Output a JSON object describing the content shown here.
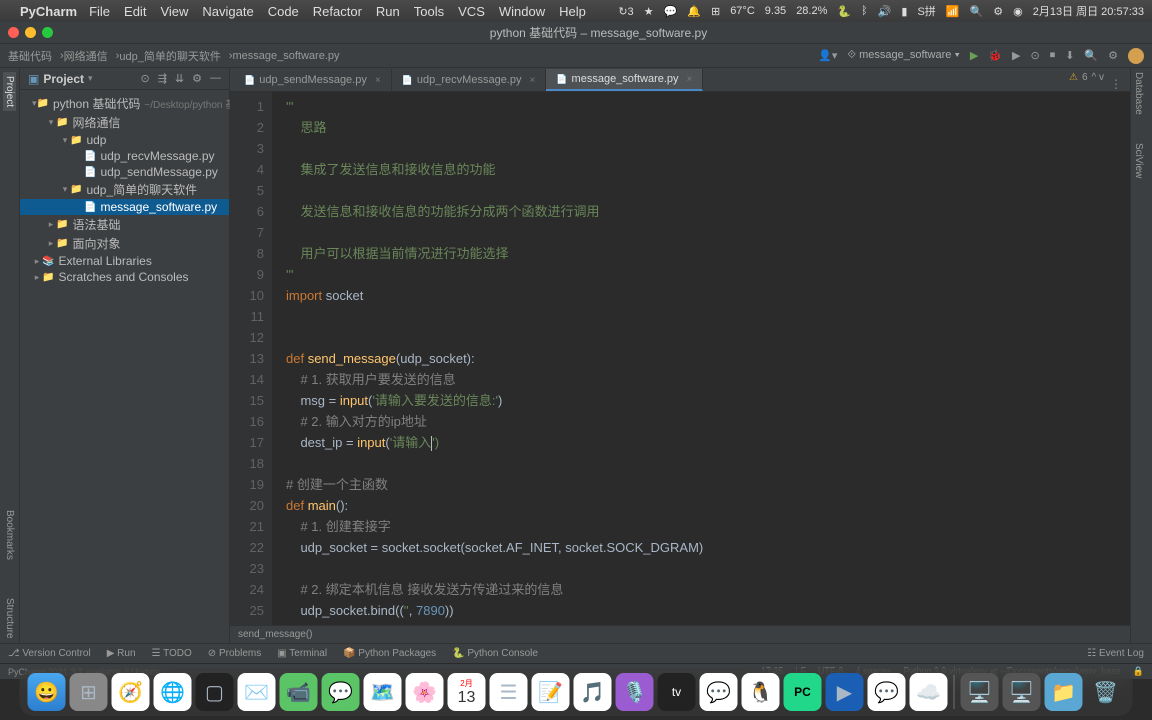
{
  "menubar": {
    "app": "PyCharm",
    "items": [
      "File",
      "Edit",
      "View",
      "Navigate",
      "Code",
      "Refactor",
      "Run",
      "Tools",
      "VCS",
      "Window",
      "Help"
    ],
    "status": {
      "temp": "67°C",
      "net": "9.35",
      "cpu": "28.2%",
      "date": "2月13日 周日 20:57:33"
    }
  },
  "window": {
    "title": "python 基础代码 – message_software.py"
  },
  "breadcrumbs": [
    "基础代码",
    "网络通信",
    "udp_简单的聊天软件",
    "message_software.py"
  ],
  "runConfig": "message_software",
  "project": {
    "header": "Project",
    "root": {
      "name": "python 基础代码",
      "path": "~/Desktop/python 基础代码"
    },
    "folders": {
      "net": "网络通信",
      "udp": "udp",
      "f1": "udp_recvMessage.py",
      "f2": "udp_sendMessage.py",
      "chat": "udp_简单的聊天软件",
      "f3": "message_software.py",
      "base": "语法基础",
      "obj": "面向对象"
    },
    "ext": "External Libraries",
    "scratch": "Scratches and Consoles"
  },
  "tabs": [
    {
      "name": "udp_sendMessage.py",
      "active": false
    },
    {
      "name": "udp_recvMessage.py",
      "active": false
    },
    {
      "name": "message_software.py",
      "active": true
    }
  ],
  "code": {
    "lines": [
      {
        "n": 1,
        "c": "'''",
        "cls": "str"
      },
      {
        "n": 2,
        "t": "    思路",
        "cls": "str"
      },
      {
        "n": 3,
        "t": "",
        "cls": ""
      },
      {
        "n": 4,
        "t": "    集成了发送信息和接收信息的功能",
        "cls": "str"
      },
      {
        "n": 5,
        "t": "",
        "cls": ""
      },
      {
        "n": 6,
        "t": "    发送信息和接收信息的功能拆分成两个函数进行调用",
        "cls": "str"
      },
      {
        "n": 7,
        "t": "",
        "cls": ""
      },
      {
        "n": 8,
        "t": "    用户可以根据当前情况进行功能选择",
        "cls": "str"
      },
      {
        "n": 9,
        "c": "'''",
        "cls": "str"
      },
      {
        "n": 10,
        "t": "",
        "cls": ""
      }
    ],
    "l10": {
      "kw": "import",
      "id": " socket"
    },
    "l13": {
      "kw": "def ",
      "fn": "send_message",
      "p": "(udp_socket):"
    },
    "l14": "    # 1. 获取用户要发送的信息",
    "l15": {
      "a": "    msg = ",
      "b": "input",
      "c": "(",
      "d": "'请输入要发送的信息:'",
      "e": ")"
    },
    "l16": "    # 2. 输入对方的ip地址",
    "l17": {
      "a": "    dest_ip = ",
      "b": "input",
      "c": "(",
      "d": "'请输入",
      "e": "')"
    },
    "l19": "# 创建一个主函数",
    "l20": {
      "kw": "def ",
      "fn": "main",
      "p": "():"
    },
    "l21": "    # 1. 创建套接字",
    "l22": "    udp_socket = socket.socket(socket.AF_INET, socket.SOCK_DGRAM)",
    "l24": "    # 2. 绑定本机信息 接收发送方传递过来的信息",
    "l25": {
      "a": "    udp_socket.bind((",
      "b": "''",
      "c": ", ",
      "d": "7890",
      "e": "))"
    }
  },
  "crumb_bottom": "send_message()",
  "analysis": {
    "warn": "6"
  },
  "bottom": {
    "vc": "Version Control",
    "run": "Run",
    "todo": "TODO",
    "prob": "Problems",
    "term": "Terminal",
    "pkg": "Python Packages",
    "pyc": "Python Console",
    "evt": "Event Log"
  },
  "status": {
    "left": "PyCharm 2021.3.2 available // Update...",
    "pos": "17:25",
    "lf": "LF",
    "enc": "UTF-8",
    "ind": "4 spaces",
    "interp": "Python 3.9 virtualenv at ~/Documents/venv/venv_base"
  },
  "dock": [
    "🔍",
    "📦",
    "🧭",
    "🌐",
    "⬛",
    "✉️",
    "📅",
    "💬",
    "🗺️",
    "📷",
    "🗓️",
    "📝",
    "📄",
    "🎵",
    "🎙️",
    "📺",
    "💬",
    "🐧",
    "⬛",
    "▶️",
    "💬",
    "☁️",
    "",
    "🖥️",
    "🖥️",
    "📁",
    "🗑️"
  ],
  "dock_date": "13"
}
